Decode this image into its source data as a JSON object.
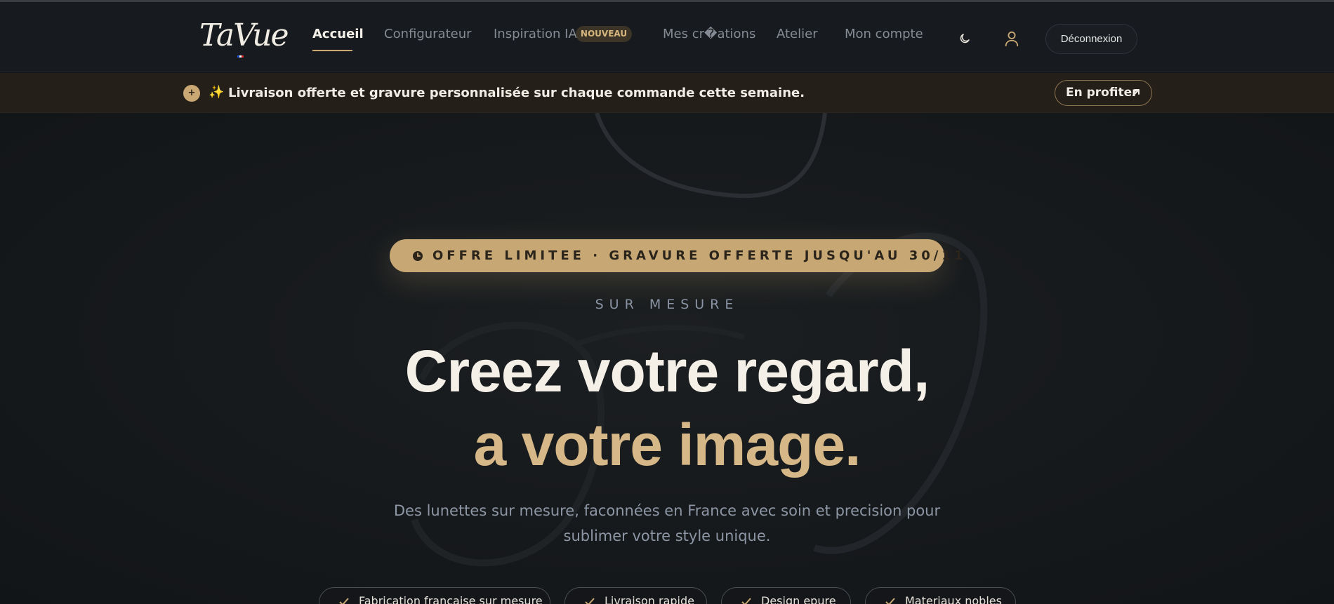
{
  "brand": {
    "name": "TaVue",
    "flag_colors": [
      "#1d4fd8",
      "#ffffff",
      "#d62828"
    ]
  },
  "nav": {
    "items": [
      {
        "label": "Accueil",
        "active": true
      },
      {
        "label": "Configurateur",
        "active": false
      },
      {
        "label": "Inspiration IA",
        "active": false,
        "badge": "NOUVEAU"
      },
      {
        "label": "Mes cr�ations",
        "active": false
      },
      {
        "label": "Atelier",
        "active": false
      },
      {
        "label": "Mon compte",
        "active": false
      }
    ],
    "theme_icon": "moon-icon",
    "user_icon": "user-icon",
    "logout_label": "Déconnexion"
  },
  "promo": {
    "plus_icon": "plus-icon",
    "sparkle": "✨",
    "text": "Livraison offerte et gravure personnalisée sur chaque commande cette semaine.",
    "cta_label": "En profiter",
    "cta_icon": "arrow-up-right-icon"
  },
  "hero": {
    "offer_icon": "clock-icon",
    "offer_text": "OFFRE LIMITEE · GRAVURE OFFERTE JUSQU'AU 30/11",
    "eyebrow": "SUR MESURE",
    "title_line1": "Creez votre regard,",
    "title_line2": "a votre image.",
    "subtitle": "Des lunettes sur mesure, faconnées en France avec soin et precision pour sublimer votre style unique.",
    "features": [
      {
        "label": "Fabrication francaise sur mesure",
        "icon": "check-icon"
      },
      {
        "label": "Livraison rapide",
        "icon": "check-icon"
      },
      {
        "label": "Design epure",
        "icon": "check-icon"
      },
      {
        "label": "Materiaux nobles",
        "icon": "check-icon"
      }
    ]
  },
  "colors": {
    "background": "#131619",
    "accent_gold": "#c7a875",
    "title_gold": "#d6b888",
    "text_light": "#f4f0e8",
    "text_muted": "#8d96a4"
  }
}
